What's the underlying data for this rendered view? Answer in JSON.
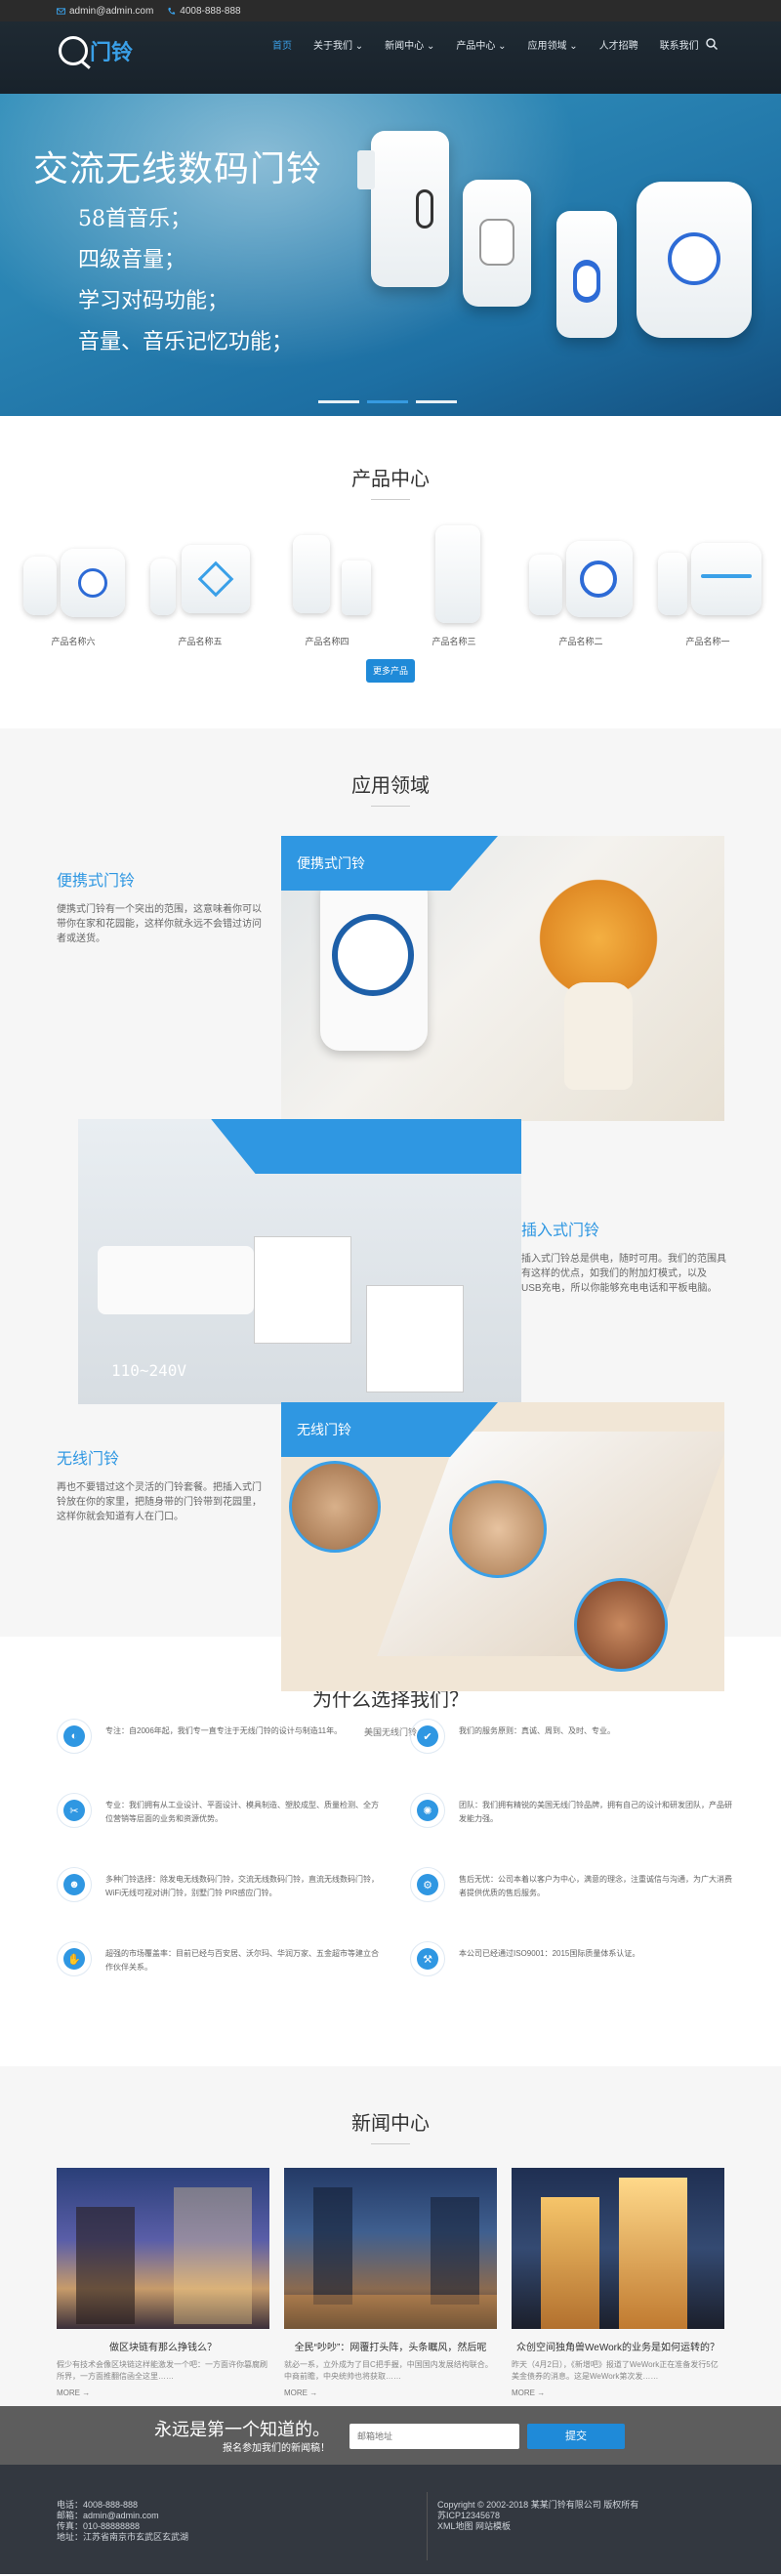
{
  "topbar": {
    "email": "admin@admin.com",
    "phone": "4008-888-888"
  },
  "nav": {
    "logo_text": "门铃",
    "items": [
      {
        "label": "首页",
        "active": true
      },
      {
        "label": "关于我们 ⌄"
      },
      {
        "label": "新闻中心 ⌄"
      },
      {
        "label": "产品中心 ⌄"
      },
      {
        "label": "应用领域 ⌄"
      },
      {
        "label": "人才招聘"
      },
      {
        "label": "联系我们"
      }
    ]
  },
  "banner": {
    "title": "交流无线数码门铃",
    "lines": [
      "58首音乐；",
      "四级音量；",
      "学习对码功能；",
      "音量、音乐记忆功能；"
    ],
    "accent": "#3aa0e8"
  },
  "products": {
    "title": "产品中心",
    "items": [
      {
        "name": "产品名称六"
      },
      {
        "name": "产品名称五"
      },
      {
        "name": "产品名称四"
      },
      {
        "name": "产品名称三"
      },
      {
        "name": "产品名称二"
      },
      {
        "name": "产品名称一"
      }
    ],
    "more_label": "更多产品"
  },
  "apps": {
    "title": "应用领域",
    "portable": {
      "label": "便携式门铃",
      "heading": "便携式门铃",
      "desc": "便携式门铃有一个突出的范围，这意味着你可以带你在家和花园能，这样你就永远不会错过访问者或送货。"
    },
    "plugin": {
      "label": "插入式门铃",
      "heading": "插入式门铃",
      "desc": "插入式门铃总是供电，随时可用。我们的范围具有这样的优点，如我们的附加灯模式，以及USB充电，所以你能够充电电话和平板电脑。",
      "overlay_text": "110~240V"
    },
    "wireless": {
      "label": "无线门铃",
      "heading": "无线门铃",
      "desc": "再也不要错过这个灵活的门铃套餐。把插入式门铃放在你的家里，把随身带的门铃带到花园里，这样你就会知道有人在门口。"
    }
  },
  "why": {
    "title": "为什么选择我们？",
    "subtitle": "美国无线门铃",
    "items": [
      {
        "icon": "globe-icon",
        "glyph": "◐",
        "text": "专注：自2006年起，我们专一直专注于无线门铃的设计与制造11年。"
      },
      {
        "icon": "shield-icon",
        "glyph": "✔",
        "text": "我们的服务原则：真诚、周到、及时、专业。"
      },
      {
        "icon": "tools-icon",
        "glyph": "✂",
        "text": "专业：我们拥有从工业设计、平面设计、模具制造、塑胶成型、质量检测、全方位营销等层面的业务和资源优势。"
      },
      {
        "icon": "atom-icon",
        "glyph": "✺",
        "text": "团队：我们拥有精锐的美国无线门铃品牌，拥有自己的设计和研发团队，产品研发能力强。"
      },
      {
        "icon": "users-icon",
        "glyph": "☻",
        "text": "多种门铃选择：除发电无线数码门铃，交流无线数码门铃，直流无线数码门铃，WiFi无线可视对讲门铃，别墅门铃 PIR感应门铃。"
      },
      {
        "icon": "gear-icon",
        "glyph": "⚙",
        "text": "售后无忧：公司本着以客户为中心，满意的理念，注重诚信与沟通，为广大消费者提供优质的售后服务。"
      },
      {
        "icon": "thumbs-up-icon",
        "glyph": "✋",
        "text": "超强的市场覆盖率：目前已经与百安居、沃尔玛、华润万家、五金超市等建立合作伙伴关系。"
      },
      {
        "icon": "wrench-icon",
        "glyph": "⚒",
        "text": "本公司已经通过ISO9001：2015国际质量体系认证。"
      }
    ]
  },
  "news": {
    "title": "新闻中心",
    "items": [
      {
        "title": "做区块链有那么挣钱么？",
        "desc": "假少有技术会像区块链这样能激发一个吧：一方面许你篡腐刷所界，一方面推翻信函全这里……",
        "more": "MORE →"
      },
      {
        "title": "全民“吵吵”：网覆打头阵，头条瞩风，然后呢",
        "desc": "就必一系，立外成为了目C把手握，中国国内发展结构联合。中商前瞻，中央统帅也将获取……",
        "more": "MORE →"
      },
      {
        "title": "众创空间独角兽WeWork的业务是如何运转的？",
        "desc": "昨天（4月2日），《新增吧》报道了WeWork正在准备发行5亿美金债券的消息。这是WeWork第次发……",
        "more": "MORE →"
      }
    ]
  },
  "subscribe": {
    "headline": "永远是第一个知道的。",
    "sub": "报名参加我们的新闻稿！",
    "placeholder": "邮箱地址",
    "button": "提交"
  },
  "footer": {
    "left": [
      "电话：4008-888-888",
      "邮箱：admin@admin.com",
      "传真：010-88888888",
      "地址：江苏省南京市玄武区玄武湖"
    ],
    "right": [
      "Copyright © 2002-2018 某某门铃有限公司 版权所有",
      "苏ICP12345678",
      "XML地图 网站模板"
    ]
  }
}
